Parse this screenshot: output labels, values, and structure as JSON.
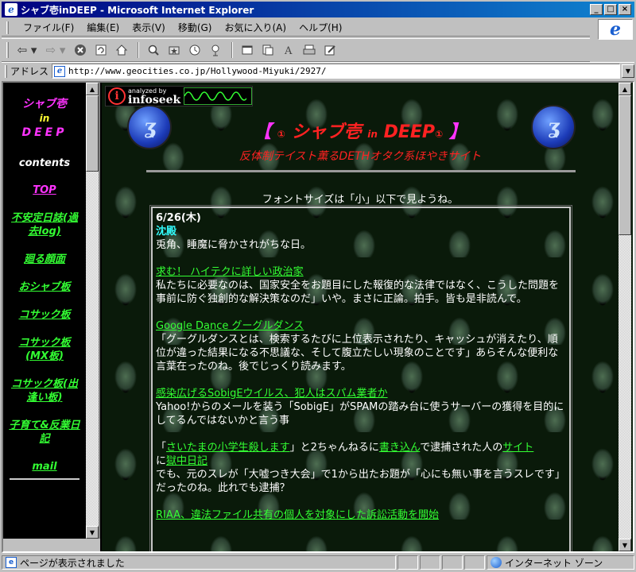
{
  "window": {
    "title": "シャブ壱inDEEP - Microsoft Internet Explorer",
    "minimize": "_",
    "maximize": "□",
    "close": "×"
  },
  "menu": [
    "ファイル(F)",
    "編集(E)",
    "表示(V)",
    "移動(G)",
    "お気に入り(A)",
    "ヘルプ(H)"
  ],
  "toolbar": {
    "icons": [
      "back-icon",
      "forward-icon",
      "stop-icon",
      "refresh-icon",
      "home-icon",
      "search-icon",
      "favorites-icon",
      "history-icon",
      "channels-icon",
      "fullscreen-icon",
      "mail-icon",
      "font-icon",
      "print-icon",
      "edit-icon"
    ],
    "back": "⇦ ▾",
    "forward": "⇨ ▾"
  },
  "address": {
    "label": "アドレス",
    "url": "http://www.geocities.co.jp/Hollywood-Miyuki/2927/"
  },
  "sidebar": {
    "logo": [
      "シャブ壱",
      "in",
      "DEEP"
    ],
    "contents_heading": "contents",
    "items": [
      {
        "label": "TOP"
      },
      {
        "label": "不安定日誌(過去log)"
      },
      {
        "label": "廻る顔面"
      },
      {
        "label": "おシャブ板"
      },
      {
        "label": "コサック板"
      },
      {
        "label": "コサック板(MX板)"
      },
      {
        "label": "コサック板(出逢い板)"
      },
      {
        "label": "子育て&反業日記"
      },
      {
        "label": "mail"
      }
    ]
  },
  "banner": {
    "infoseek_small": "analyzed by",
    "infoseek_brand": "infoseek",
    "title_open": "【",
    "title_mark": "①",
    "title_main": "シャブ壱",
    "title_in": "in",
    "title_deep": "DEEP",
    "title_close": "】",
    "subtitle": "反体制テイスト薫るDETHオタク系ほやきサイト",
    "font_note": "フォントサイズは「小」以下で見ようね。"
  },
  "diary": {
    "date": "6/26(木)",
    "day_title": "沈殿",
    "day_text": "兎角、睡魔に脅かされがちな日。",
    "entries": [
      {
        "link": "求む！ ハイテクに詳しい政治家",
        "text": "私たちに必要なのは、国家安全をお題目にした報復的な法律ではなく、こうした問題を事前に防ぐ独創的な解決策なのだ」いや。まさに正論。拍手。皆も是非読んで。"
      },
      {
        "link": "Google Dance グーグルダンス",
        "text": "「グーグルダンスとは、検索するたびに上位表示されたり、キャッシュが消えたり、順位が違った結果になる不思議な、そして腹立たしい現象のことです」あらそんな便利な言葉在ったのね。後でじっくり読みます。"
      },
      {
        "link": "感染広げるSobigEウイルス、犯人はスパム業者か",
        "text": "Yahoo!からのメールを装う「SobigE」がSPAMの踏み台に使うサーバーの獲得を目的にしてるんではないかと言う事"
      }
    ],
    "last": {
      "p1": "「",
      "link1": "さいたまの小学生殺します",
      "p2": "」と2ちゃんねるに",
      "link2": "書き込ん",
      "p3": "で逮捕された人の",
      "link3": "サイト",
      "p4": "に",
      "link4": "獄中日記",
      "text": "でも、元のスレが「大嘘つき大会」で1から出たお題が「心にも無い事を言うスレです」だったのね。此れでも逮捕？",
      "next": "RIAA、違法ファイル共有の個人を対象にした訴訟活動を開始"
    }
  },
  "status": {
    "text": "ページが表示されました",
    "zone": "インターネット ゾーン"
  }
}
